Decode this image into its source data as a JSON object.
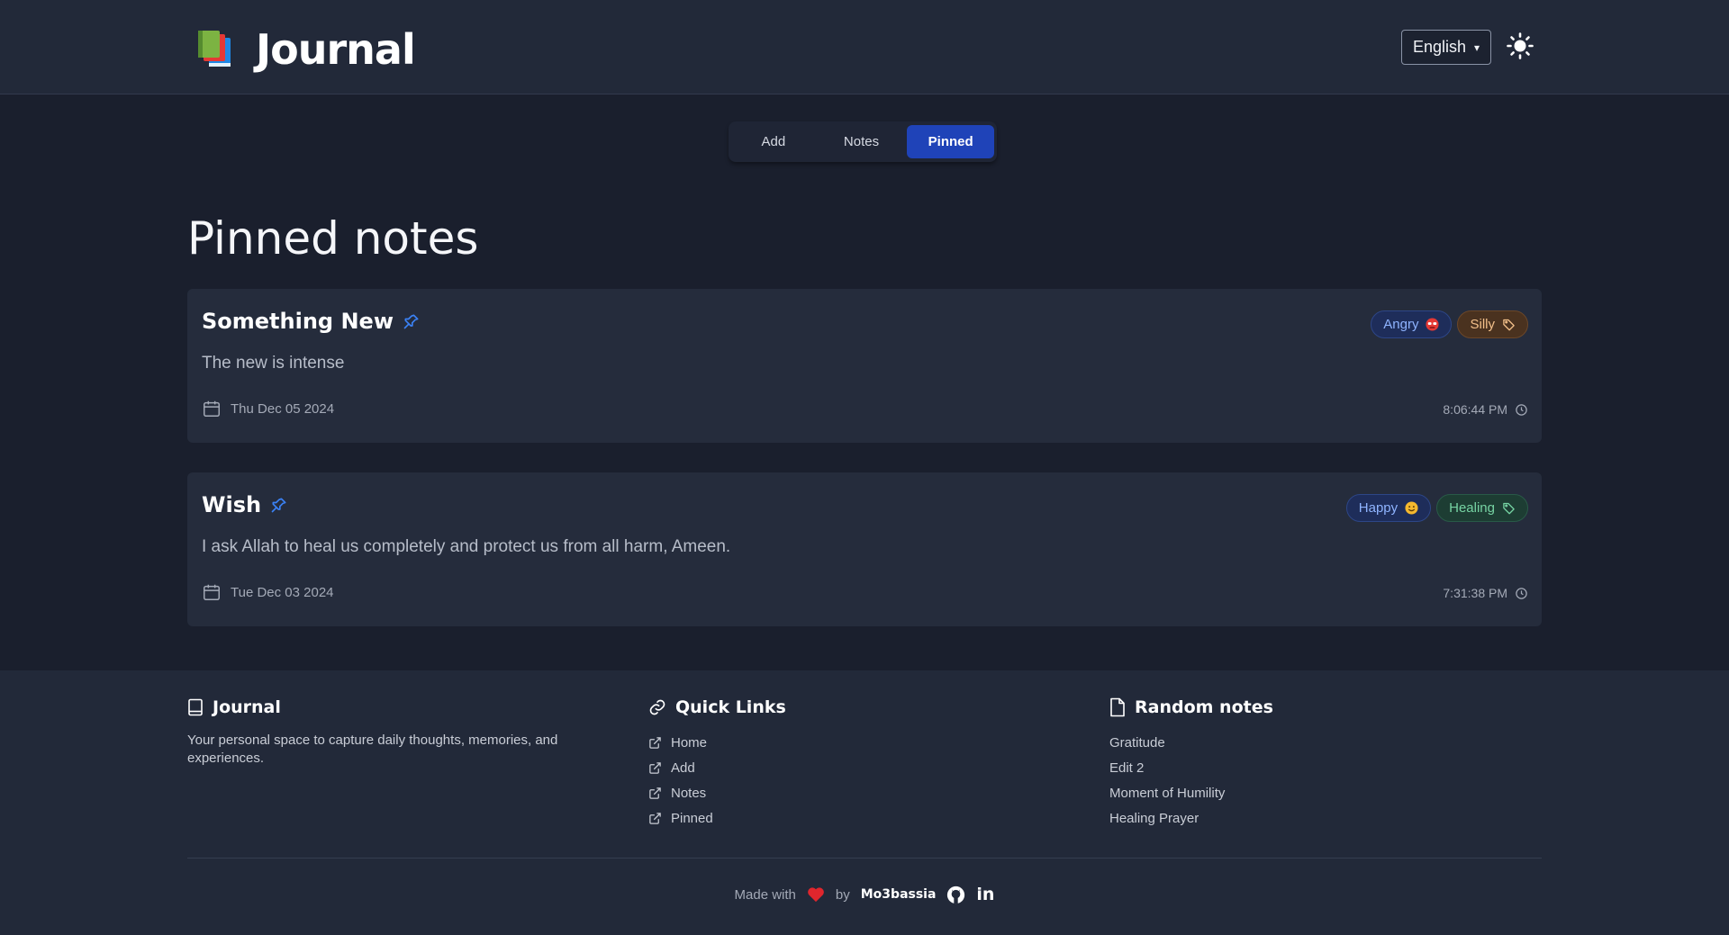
{
  "header": {
    "app_title": "Journal",
    "language": "English"
  },
  "tabs": [
    {
      "label": "Add"
    },
    {
      "label": "Notes"
    },
    {
      "label": "Pinned"
    }
  ],
  "main": {
    "title": "Pinned notes",
    "notes": [
      {
        "title": "Something New",
        "body": "The new is intense",
        "date": "Thu Dec 05 2024",
        "time": "8:06:44 PM",
        "mood": "Angry",
        "tag": "Silly"
      },
      {
        "title": "Wish",
        "body": "I ask Allah to heal us completely and protect us from all harm, Ameen.",
        "date": "Tue Dec 03 2024",
        "time": "7:31:38 PM",
        "mood": "Happy",
        "tag": "Healing"
      }
    ]
  },
  "footer": {
    "about": {
      "title": "Journal",
      "description": "Your personal space to capture daily thoughts, memories, and experiences."
    },
    "quick_links": {
      "title": "Quick Links",
      "items": [
        "Home",
        "Add",
        "Notes",
        "Pinned"
      ]
    },
    "random_notes": {
      "title": "Random notes",
      "items": [
        "Gratitude",
        "Edit 2",
        "Moment of Humility",
        "Healing Prayer"
      ]
    },
    "credit": {
      "made_with": "Made with",
      "by": "by",
      "author": "Mo3bassia",
      "linkedin": "in"
    }
  },
  "colors": {
    "accent": "#1f43b8",
    "background": "#1a1f2d",
    "card": "#252c3c",
    "heart": "#e0262d"
  }
}
